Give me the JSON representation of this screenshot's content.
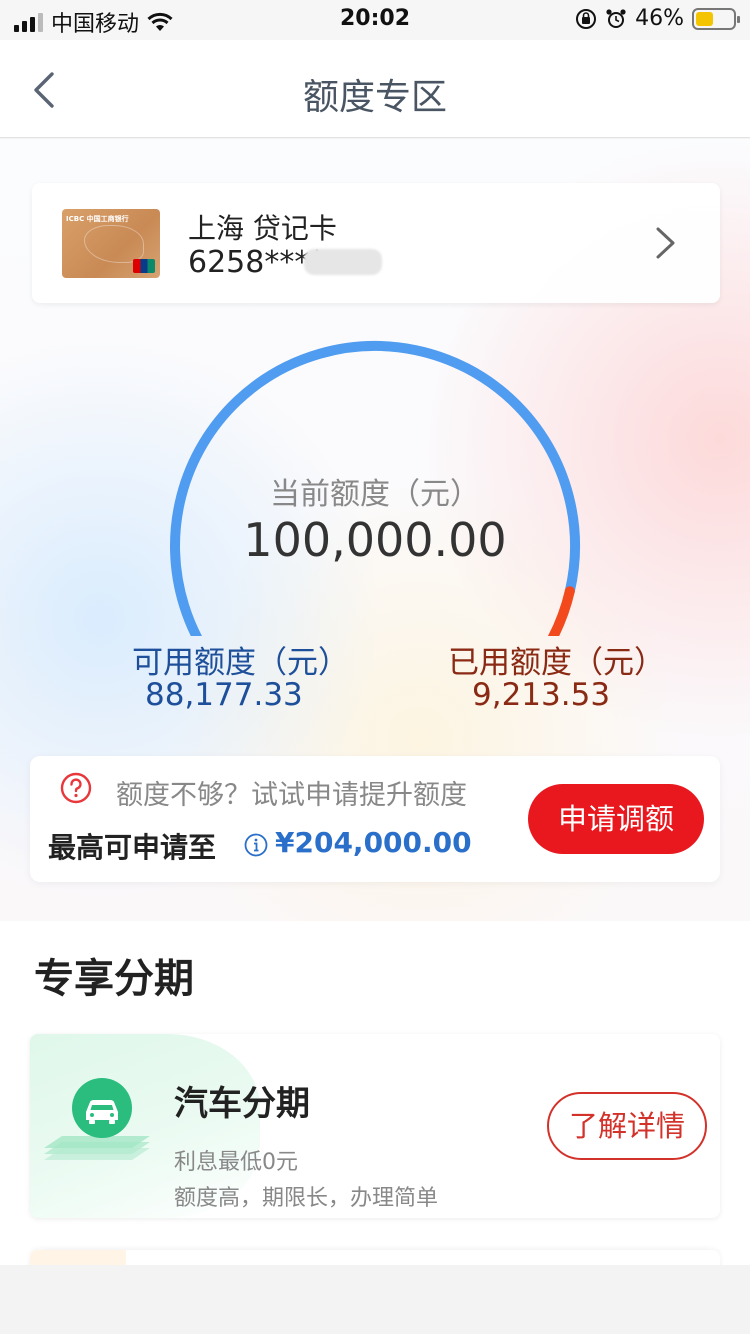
{
  "status_bar": {
    "carrier": "中国移动",
    "time": "20:02",
    "battery_percent": "46%",
    "battery_level": 0.46
  },
  "nav": {
    "title": "额度专区",
    "back_icon": "chevron-left-icon"
  },
  "card": {
    "name": "上海 贷记卡",
    "number": "6258****",
    "bank_mark": "ICBC 中国工商银行",
    "chevron_icon": "chevron-right-icon"
  },
  "credit": {
    "current_label": "当前额度（元）",
    "current_value": "100,000.00",
    "available_label": "可用额度（元）",
    "available_value": "88,177.33",
    "used_label": "已用额度（元）",
    "used_value": "9,213.53",
    "gauge_available_fraction": 0.88177,
    "colors": {
      "available": "#4f9cf0",
      "used": "#f24a1c"
    }
  },
  "raise": {
    "hint": "额度不够？试试申请提升额度",
    "max_label": "最高可申请至",
    "max_value": "¥204,000.00",
    "apply_label": "申请调额"
  },
  "section": {
    "title": "专享分期",
    "products": [
      {
        "title": "汽车分期",
        "sub1": "利息最低0元",
        "sub2": "额度高，期限长，办理简单",
        "button": "了解详情",
        "icon": "car-icon"
      }
    ]
  },
  "colors": {
    "accent_red": "#e8181e",
    "link_blue": "#2a6fc9"
  }
}
